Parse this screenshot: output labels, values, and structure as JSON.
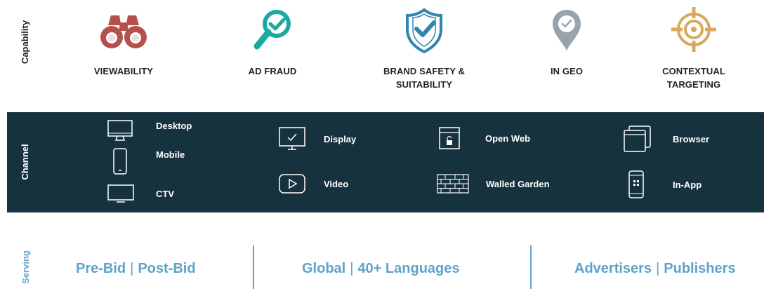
{
  "sections": {
    "capability": "Capability",
    "channel": "Channel",
    "serving": "Serving"
  },
  "capabilities": [
    {
      "line1": "VIEWABILITY",
      "line2": "",
      "icon": "binoculars-icon",
      "color": "#b4514c"
    },
    {
      "line1": "AD FRAUD",
      "line2": "",
      "icon": "magnifier-check-icon",
      "color": "#1ca9a1"
    },
    {
      "line1": "BRAND SAFETY &",
      "line2": "SUITABILITY",
      "icon": "shield-check-icon",
      "color": "#2f86b0"
    },
    {
      "line1": "IN GEO",
      "line2": "",
      "icon": "map-pin-check-icon",
      "color": "#9aa3a9"
    },
    {
      "line1": "CONTEXTUAL",
      "line2": "TARGETING",
      "icon": "crosshair-target-icon",
      "color": "#d9a95d"
    }
  ],
  "channels": {
    "devices": [
      "Desktop",
      "Mobile",
      "CTV"
    ],
    "formats": [
      "Display",
      "Video"
    ],
    "environments": [
      "Open Web",
      "Walled Garden"
    ],
    "platforms": [
      "Browser",
      "In-App"
    ]
  },
  "serving": {
    "group1": {
      "a": "Pre-Bid",
      "sep": "|",
      "b": "Post-Bid"
    },
    "group2": {
      "a": "Global",
      "sep": "|",
      "b": "40+ Languages"
    },
    "group3": {
      "a": "Advertisers",
      "sep": "|",
      "b": "Publishers"
    }
  },
  "colors": {
    "band": "#17323f",
    "serving_text": "#5fa2c9",
    "dark_text": "#1e2327"
  }
}
